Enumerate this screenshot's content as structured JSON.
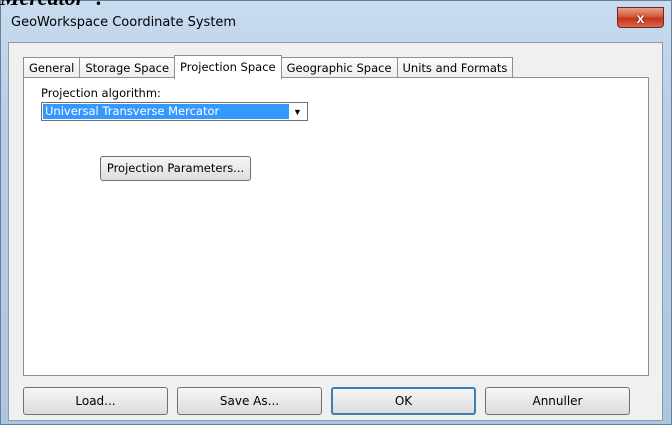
{
  "window": {
    "title": "GeoWorkspace Coordinate System",
    "close_label": "x"
  },
  "tabs": [
    {
      "label": "General"
    },
    {
      "label": "Storage Space"
    },
    {
      "label": "Projection Space",
      "active": true
    },
    {
      "label": "Geographic Space"
    },
    {
      "label": "Units and Formats"
    }
  ],
  "projection": {
    "label": "Projection algorithm:",
    "selected": "Universal Transverse Mercator",
    "parameters_button": "Projection Parameters..."
  },
  "buttons": {
    "load": "Load...",
    "save_as": "Save As...",
    "ok": "OK",
    "cancel": "Annuller"
  },
  "background_text": "Mercator\"."
}
